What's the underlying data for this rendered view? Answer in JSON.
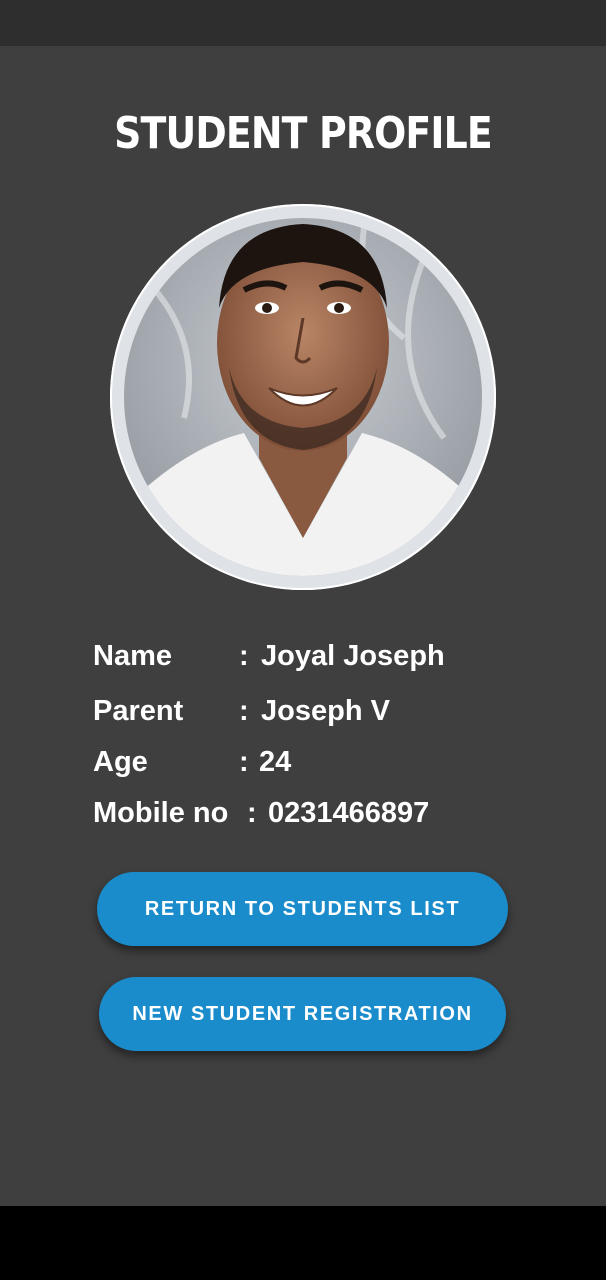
{
  "page": {
    "title": "STUDENT PROFILE"
  },
  "profile": {
    "photo_alt": "Student photo",
    "fields": [
      {
        "label": "Name",
        "separator": ":",
        "value": "Joyal Joseph"
      },
      {
        "label": "Parent",
        "separator": ":",
        "value": "Joseph V"
      },
      {
        "label": "Age",
        "separator": ":",
        "value": "24"
      },
      {
        "label": "Mobile no",
        "separator": ":",
        "value": "0231466897"
      }
    ]
  },
  "actions": {
    "return_label": "RETURN TO STUDENTS LIST",
    "register_label": "NEW STUDENT REGISTRATION"
  },
  "colors": {
    "background": "#3f3f3f",
    "status_bar": "#2e2e2e",
    "button": "#1a8ccb",
    "text": "#ffffff",
    "nav_bar": "#000000"
  }
}
